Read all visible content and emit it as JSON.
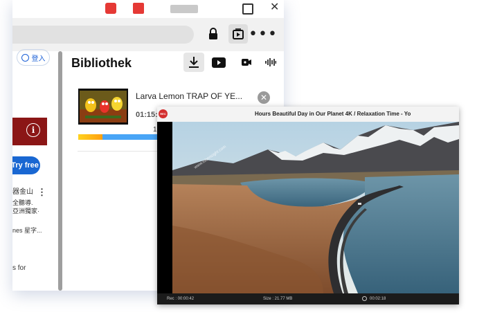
{
  "window": {
    "toolbar": {
      "more_label": "•••"
    }
  },
  "web": {
    "login_label": "登入",
    "try_free_label": "Try free",
    "side_texts": [
      "器金山",
      "全聽導.",
      "亞洲獨家·",
      "nes 星字...",
      "s for"
    ]
  },
  "library": {
    "title": "Bibliothek",
    "item": {
      "title": "Larva Lemon  TRAP OF YE...",
      "time": "01:15:",
      "count": "1",
      "progress": 0.23
    }
  },
  "recorder": {
    "badge": "REC",
    "title": "Hours Beautiful Day in Our Planet 4K / Relaxation Time - Yo",
    "watermark": "www.iobensight.com",
    "status": {
      "rec": "Rec : 00:00:42",
      "size": "Size : 21.77 MB",
      "timer": "00:02:18"
    }
  },
  "colors": {
    "accent_blue": "#1967d2",
    "progress_blue": "#49a5f6",
    "progress_orange": "#ffb015",
    "rec_red": "#d32f2f",
    "web_red": "#8b1616"
  }
}
